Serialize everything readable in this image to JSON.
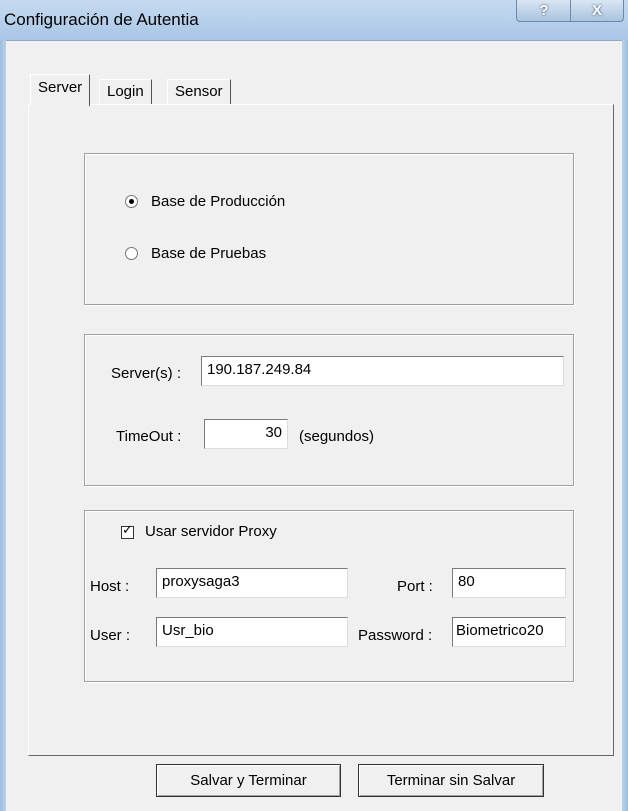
{
  "window": {
    "title": "Configuración de Autentia",
    "help_label": "?",
    "close_label": "X"
  },
  "tabs": [
    {
      "label": "Server",
      "active": true
    },
    {
      "label": "Login",
      "active": false
    },
    {
      "label": "Sensor",
      "active": false
    }
  ],
  "database": {
    "options": [
      {
        "label": "Base de Producción",
        "selected": true
      },
      {
        "label": "Base de Pruebas",
        "selected": false
      }
    ]
  },
  "server": {
    "servers_label": "Server(s) :",
    "servers_value": "190.187.249.84",
    "timeout_label": "TimeOut :",
    "timeout_value": "30",
    "timeout_unit": "(segundos)"
  },
  "proxy": {
    "use_label": "Usar servidor Proxy",
    "use_checked": true,
    "host_label": "Host :",
    "host_value": "proxysaga3",
    "port_label": "Port :",
    "port_value": "80",
    "user_label": "User :",
    "user_value": "Usr_bio",
    "password_label": "Password :",
    "password_value": "Biometrico20"
  },
  "buttons": {
    "save": "Salvar y Terminar",
    "exit": "Terminar sin Salvar"
  }
}
